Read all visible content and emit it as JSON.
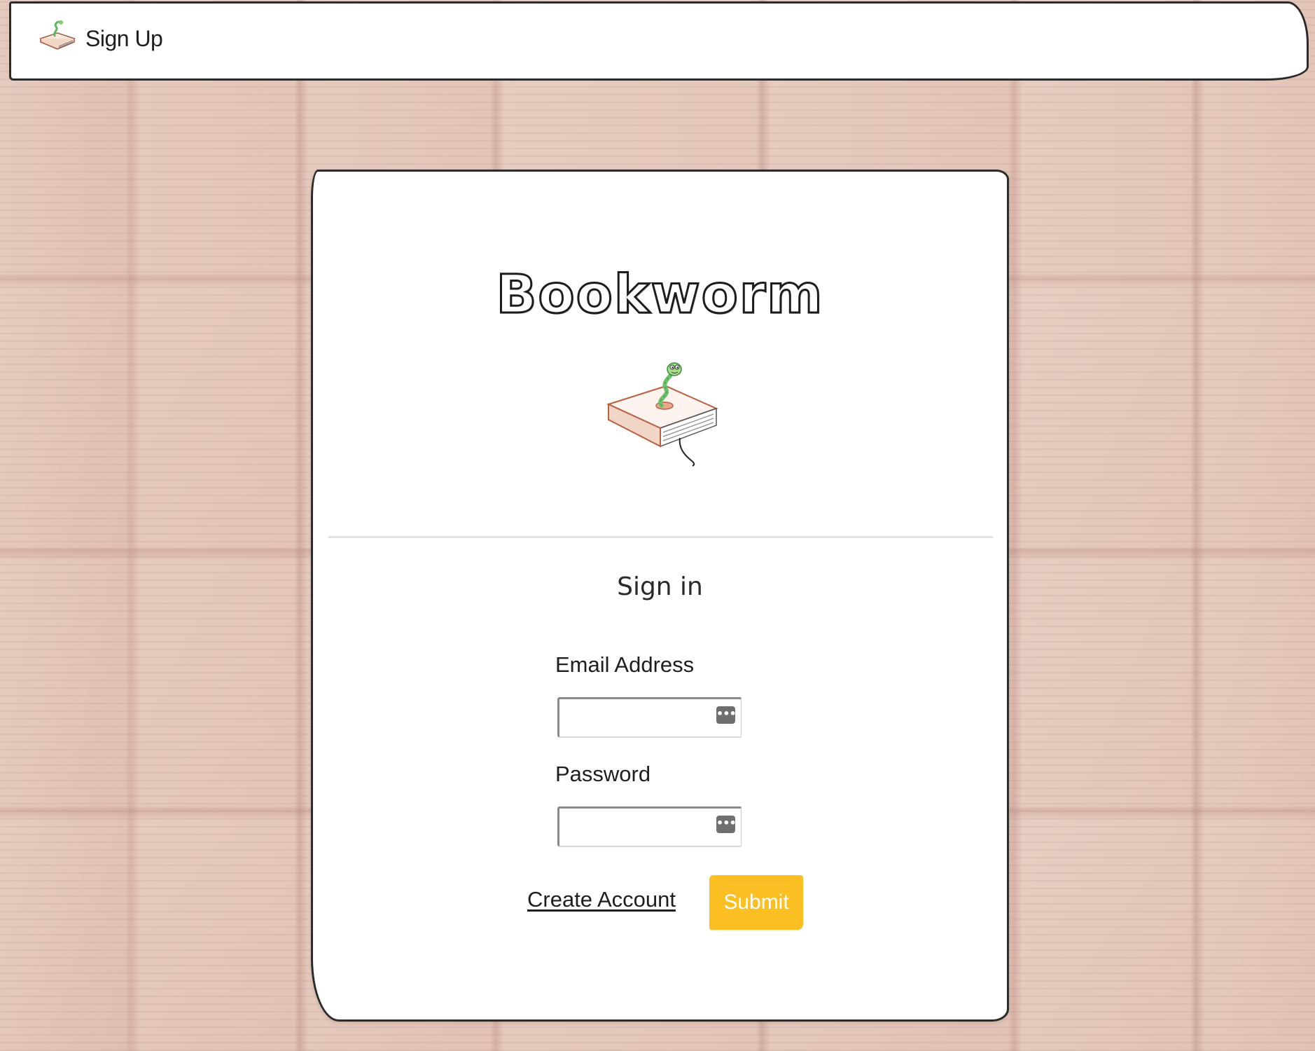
{
  "topbar": {
    "logo_icon": "bookworm-logo-icon",
    "title": "Sign Up"
  },
  "card": {
    "brand_title": "Bookworm",
    "brand_logo_icon": "bookworm-on-book-icon",
    "heading": "Sign in",
    "email": {
      "label": "Email Address",
      "value": "",
      "placeholder": "",
      "icon": "password-manager-key-icon"
    },
    "password": {
      "label": "Password",
      "value": "",
      "placeholder": "",
      "icon": "password-manager-key-icon"
    },
    "create_account_label": "Create Account",
    "submit_label": "Submit"
  },
  "colors": {
    "submit_button": "#fbbf24",
    "card_background": "#ffffff",
    "outline": "#2b2b2b"
  }
}
